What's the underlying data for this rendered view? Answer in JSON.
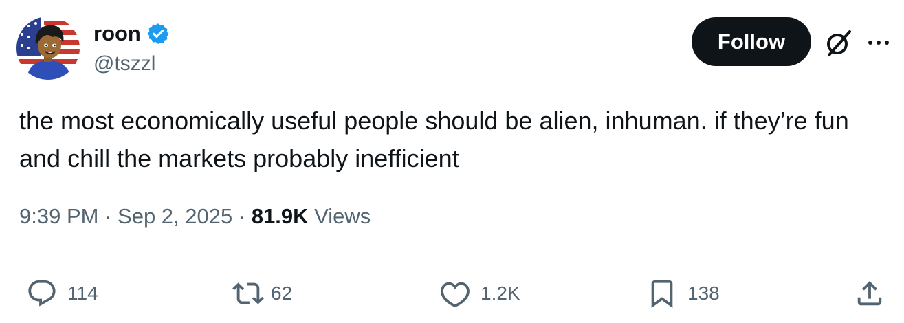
{
  "author": {
    "display_name": "roon",
    "handle": "@tszzl",
    "verified": true,
    "avatar_icon": "avatar-cartoon-flag-icon"
  },
  "header": {
    "follow_label": "Follow",
    "grok_icon": "grok-slash-icon",
    "more_icon": "more-dots-icon"
  },
  "tweet": {
    "text": "the most economically useful people should be alien, inhuman. if they’re fun and chill the markets probably inefficient",
    "time": "9:39 PM",
    "separator": "·",
    "date": "Sep 2, 2025",
    "views_count": "81.9K",
    "views_label": "Views"
  },
  "actions": {
    "replies": "114",
    "reposts": "62",
    "likes": "1.2K",
    "bookmarks": "138"
  },
  "colors": {
    "text_primary": "#0f1419",
    "text_secondary": "#536471",
    "verified_blue": "#1d9bf0",
    "follow_bg": "#0f1419",
    "divider": "#eff3f4"
  }
}
